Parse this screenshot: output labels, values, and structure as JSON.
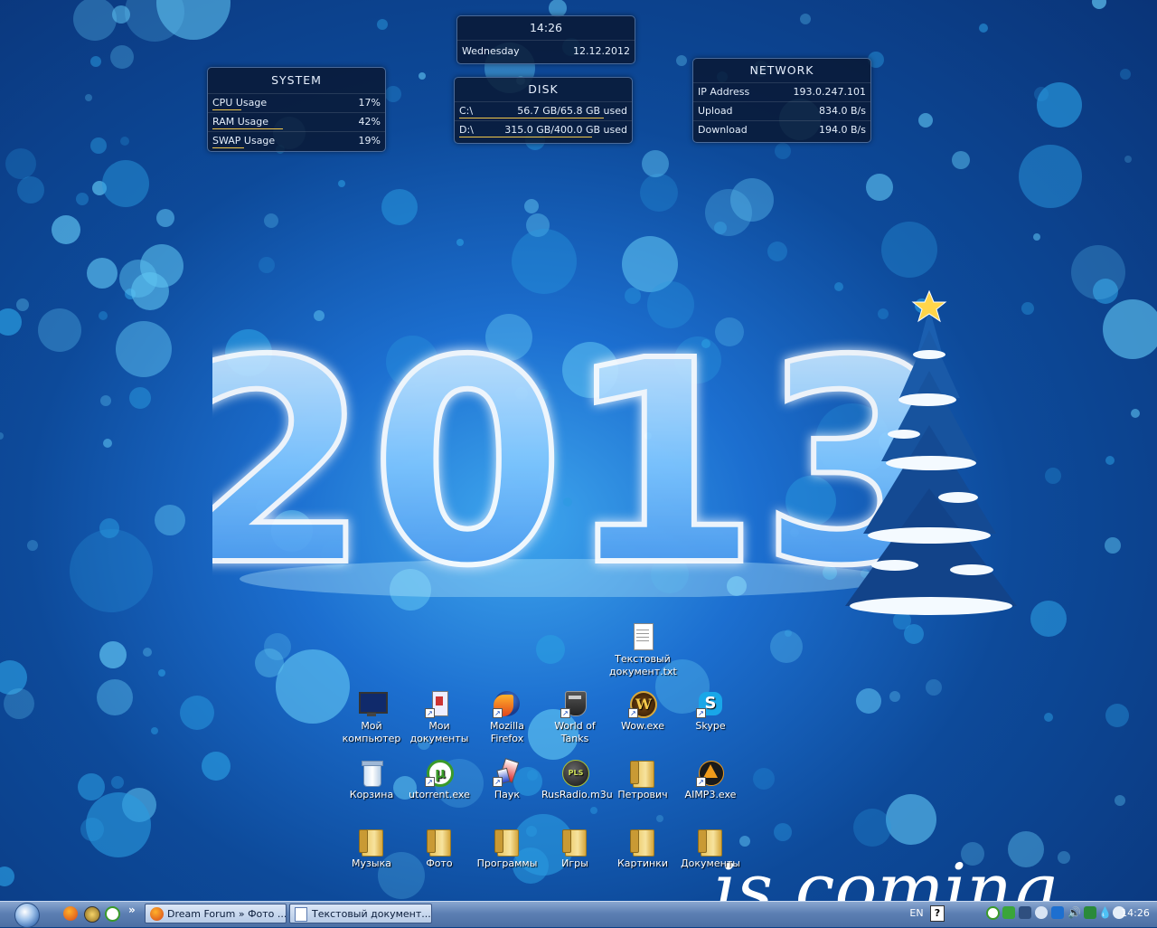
{
  "widgets": {
    "clock": {
      "time": "14:26",
      "day": "Wednesday",
      "date": "12.12.2012"
    },
    "system": {
      "title": "SYSTEM",
      "rows": [
        {
          "label": "CPU Usage",
          "value": "17%",
          "percent": 17
        },
        {
          "label": "RAM Usage",
          "value": "42%",
          "percent": 42
        },
        {
          "label": "SWAP Usage",
          "value": "19%",
          "percent": 19
        }
      ]
    },
    "disk": {
      "title": "DISK",
      "rows": [
        {
          "label": "C:\\",
          "value": "56.7 GB/65.8 GB used",
          "percent": 86
        },
        {
          "label": "D:\\",
          "value": "315.0 GB/400.0 GB used",
          "percent": 79
        }
      ]
    },
    "network": {
      "title": "NETWORK",
      "rows": [
        {
          "label": "IP Address",
          "value": "193.0.247.101"
        },
        {
          "label": "Upload",
          "value": "834.0 B/s"
        },
        {
          "label": "Download",
          "value": "194.0 B/s"
        }
      ]
    }
  },
  "wallpaper": {
    "year_text": "2013",
    "bottom_text": "is coming"
  },
  "desktop_icons": [
    {
      "label": "Текстовый документ.txt",
      "icon": "text-file-icon"
    },
    {
      "label": "Мой компьютер",
      "icon": "monitor-icon"
    },
    {
      "label": "Мои документы",
      "icon": "my-documents-icon"
    },
    {
      "label": "Mozilla Firefox",
      "icon": "firefox-icon"
    },
    {
      "label": "World of Tanks",
      "icon": "world-of-tanks-icon"
    },
    {
      "label": "Wow.exe",
      "icon": "wow-icon"
    },
    {
      "label": "Skype",
      "icon": "skype-icon"
    },
    {
      "label": "Корзина",
      "icon": "recycle-bin-icon"
    },
    {
      "label": "utorrent.exe",
      "icon": "utorrent-icon"
    },
    {
      "label": "Паук",
      "icon": "spider-icon"
    },
    {
      "label": "RusRadio.m3u",
      "icon": "playlist-icon"
    },
    {
      "label": "Петрович",
      "icon": "folder-icon"
    },
    {
      "label": "AIMP3.exe",
      "icon": "aimp-icon"
    },
    {
      "label": "Музыка",
      "icon": "folder-icon"
    },
    {
      "label": "Фото",
      "icon": "folder-icon"
    },
    {
      "label": "Программы",
      "icon": "folder-icon"
    },
    {
      "label": "Игры",
      "icon": "folder-icon"
    },
    {
      "label": "Картинки",
      "icon": "folder-icon"
    },
    {
      "label": "Документы",
      "icon": "folder-icon"
    }
  ],
  "taskbar": {
    "quicklaunch_more": "»",
    "buttons": [
      {
        "label": "Dream Forum » Фото ...",
        "icon": "firefox-icon"
      },
      {
        "label": "Текстовый документ....",
        "icon": "notepad-icon"
      }
    ],
    "language": "EN",
    "help": "?",
    "clock": "14:26"
  },
  "colors": {
    "widget_bg": "#081630",
    "bar": "#f3c84a",
    "taskbar": "#5c7fb3"
  }
}
